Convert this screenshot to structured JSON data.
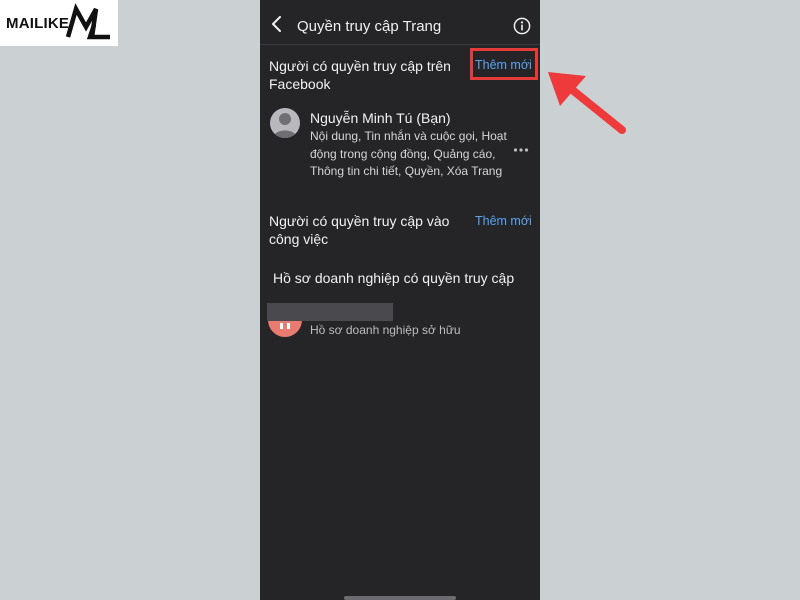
{
  "watermark": {
    "brand": "MAILIKE"
  },
  "header": {
    "title": "Quyền truy cập Trang"
  },
  "sections": {
    "facebook_access": {
      "title": "Người có quyền truy cập trên Facebook",
      "add_label": "Thêm mới",
      "user": {
        "name": "Nguyễn Minh Tú (Bạn)",
        "permissions": "Nội dung, Tin nhắn và cuộc gọi, Hoạt động trong cộng đồng, Quảng cáo, Thông tin chi tiết, Quyền, Xóa Trang"
      }
    },
    "task_access": {
      "title": "Người có quyền truy cập vào công việc",
      "add_label": "Thêm mới"
    },
    "business_access": {
      "title": "Hồ sơ doanh nghiệp có quyền truy cập",
      "item_subtitle": "Hồ sơ doanh nghiệp sở hữu"
    }
  },
  "colors": {
    "screen_bg": "#252528",
    "link": "#5aa4f2",
    "highlight": "#e63b3b",
    "page_bg": "#cbd1d3"
  },
  "icons": [
    "back-chevron-icon",
    "info-icon",
    "more-dots-icon",
    "avatar-silhouette-icon",
    "red-arrow-annotation"
  ]
}
